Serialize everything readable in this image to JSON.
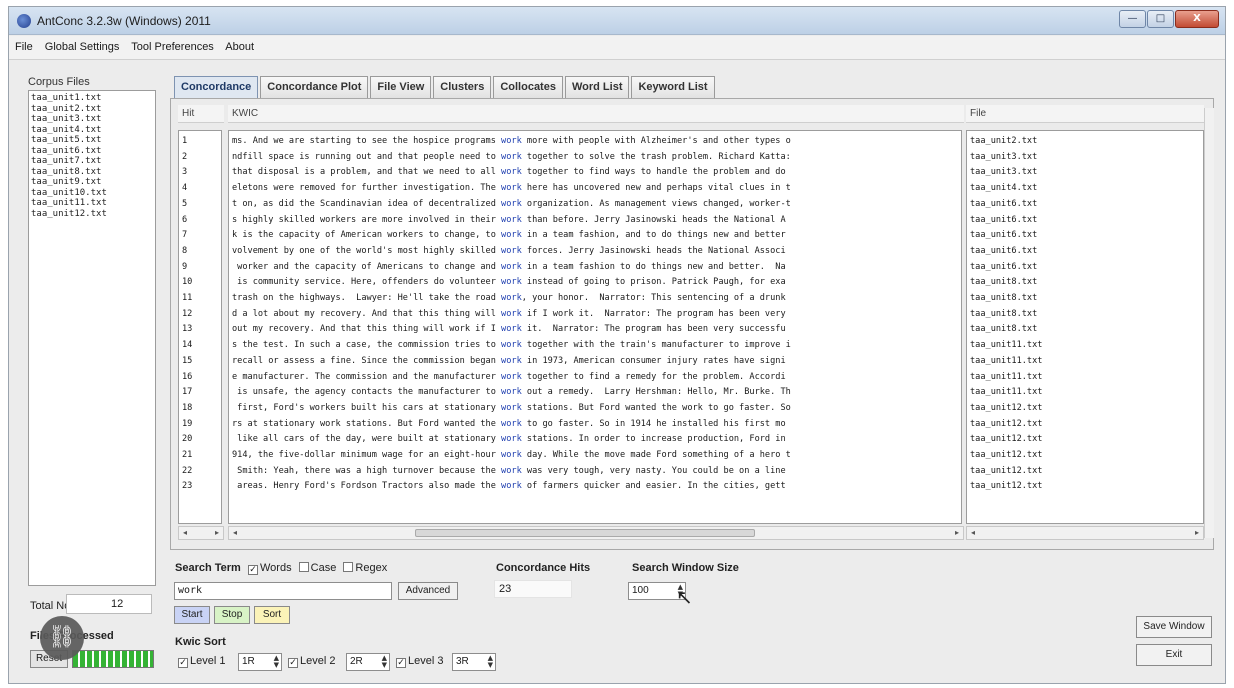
{
  "window": {
    "title": "AntConc 3.2.3w (Windows) 2011",
    "controls": {
      "minimize": "—",
      "maximize": "□",
      "close": "X"
    }
  },
  "menu": [
    "File",
    "Global Settings",
    "Tool Preferences",
    "About"
  ],
  "corpus": {
    "label": "Corpus Files",
    "files": [
      "taa_unit1.txt",
      "taa_unit2.txt",
      "taa_unit3.txt",
      "taa_unit4.txt",
      "taa_unit5.txt",
      "taa_unit6.txt",
      "taa_unit7.txt",
      "taa_unit8.txt",
      "taa_unit9.txt",
      "taa_unit10.txt",
      "taa_unit11.txt",
      "taa_unit12.txt"
    ],
    "total_label": "Total No.",
    "total_value": "12",
    "files_processed_label": "Files Processed",
    "reset_label": "Reset"
  },
  "tabs": [
    "Concordance",
    "Concordance Plot",
    "File View",
    "Clusters",
    "Collocates",
    "Word List",
    "Keyword List"
  ],
  "table": {
    "hit_header": "Hit",
    "kwic_header": "KWIC",
    "file_header": "File",
    "rows": [
      {
        "hit": "1",
        "left": "ms. And we are starting to see the hospice programs ",
        "kw": "work",
        "right": " more with people with Alzheimer's and other types o",
        "file": "taa_unit2.txt"
      },
      {
        "hit": "2",
        "left": "ndfill space is running out and that people need to ",
        "kw": "work",
        "right": " together to solve the trash problem. Richard Katta:",
        "file": "taa_unit3.txt"
      },
      {
        "hit": "3",
        "left": "that disposal is a problem, and that we need to all ",
        "kw": "work",
        "right": " together to find ways to handle the problem and do",
        "file": "taa_unit3.txt"
      },
      {
        "hit": "4",
        "left": "eletons were removed for further investigation. The ",
        "kw": "work",
        "right": " here has uncovered new and perhaps vital clues in t",
        "file": "taa_unit4.txt"
      },
      {
        "hit": "5",
        "left": "t on, as did the Scandinavian idea of decentralized ",
        "kw": "work",
        "right": " organization. As management views changed, worker-t",
        "file": "taa_unit6.txt"
      },
      {
        "hit": "6",
        "left": "s highly skilled workers are more involved in their ",
        "kw": "work",
        "right": " than before. Jerry Jasinowski heads the National A",
        "file": "taa_unit6.txt"
      },
      {
        "hit": "7",
        "left": "k is the capacity of American workers to change, to ",
        "kw": "work",
        "right": " in a team fashion, and to do things new and better",
        "file": "taa_unit6.txt"
      },
      {
        "hit": "8",
        "left": "volvement by one of the world's most highly skilled ",
        "kw": "work",
        "right": " forces. Jerry Jasinowski heads the National Associ",
        "file": "taa_unit6.txt"
      },
      {
        "hit": "9",
        "left": " worker and the capacity of Americans to change and ",
        "kw": "work",
        "right": " in a team fashion to do things new and better.  Na",
        "file": "taa_unit6.txt"
      },
      {
        "hit": "10",
        "left": " is community service. Here, offenders do volunteer ",
        "kw": "work",
        "right": " instead of going to prison. Patrick Paugh, for exa",
        "file": "taa_unit8.txt"
      },
      {
        "hit": "11",
        "left": "trash on the highways.  Lawyer: He'll take the road ",
        "kw": "work",
        "right": ", your honor.  Narrator: This sentencing of a drunk",
        "file": "taa_unit8.txt"
      },
      {
        "hit": "12",
        "left": "d a lot about my recovery. And that this thing will ",
        "kw": "work",
        "right": " if I work it.  Narrator: The program has been very",
        "file": "taa_unit8.txt"
      },
      {
        "hit": "13",
        "left": "out my recovery. And that this thing will work if I ",
        "kw": "work",
        "right": " it.  Narrator: The program has been very successfu",
        "file": "taa_unit8.txt"
      },
      {
        "hit": "14",
        "left": "s the test. In such a case, the commission tries to ",
        "kw": "work",
        "right": " together with the train's manufacturer to improve i",
        "file": "taa_unit11.txt"
      },
      {
        "hit": "15",
        "left": "recall or assess a fine. Since the commission began ",
        "kw": "work",
        "right": " in 1973, American consumer injury rates have signi",
        "file": "taa_unit11.txt"
      },
      {
        "hit": "16",
        "left": "e manufacturer. The commission and the manufacturer ",
        "kw": "work",
        "right": " together to find a remedy for the problem. Accordi",
        "file": "taa_unit11.txt"
      },
      {
        "hit": "17",
        "left": " is unsafe, the agency contacts the manufacturer to ",
        "kw": "work",
        "right": " out a remedy.  Larry Hershman: Hello, Mr. Burke. Th",
        "file": "taa_unit11.txt"
      },
      {
        "hit": "18",
        "left": " first, Ford's workers built his cars at stationary ",
        "kw": "work",
        "right": " stations. But Ford wanted the work to go faster. So",
        "file": "taa_unit12.txt"
      },
      {
        "hit": "19",
        "left": "rs at stationary work stations. But Ford wanted the ",
        "kw": "work",
        "right": " to go faster. So in 1914 he installed his first mo",
        "file": "taa_unit12.txt"
      },
      {
        "hit": "20",
        "left": " like all cars of the day, were built at stationary ",
        "kw": "work",
        "right": " stations. In order to increase production, Ford in",
        "file": "taa_unit12.txt"
      },
      {
        "hit": "21",
        "left": "914, the five-dollar minimum wage for an eight-hour ",
        "kw": "work",
        "right": " day. While the move made Ford something of a hero t",
        "file": "taa_unit12.txt"
      },
      {
        "hit": "22",
        "left": " Smith: Yeah, there was a high turnover because the ",
        "kw": "work",
        "right": " was very tough, very nasty. You could be on a line",
        "file": "taa_unit12.txt"
      },
      {
        "hit": "23",
        "left": " areas. Henry Ford's Fordson Tractors also made the ",
        "kw": "work",
        "right": " of farmers quicker and easier. In the cities, gett",
        "file": "taa_unit12.txt"
      }
    ]
  },
  "search": {
    "term_label": "Search Term",
    "words_label": "Words",
    "case_label": "Case",
    "regex_label": "Regex",
    "value": "work",
    "advanced_label": "Advanced",
    "start_label": "Start",
    "stop_label": "Stop",
    "sort_label": "Sort"
  },
  "hits": {
    "label": "Concordance Hits",
    "value": "23"
  },
  "window_size": {
    "label": "Search Window Size",
    "value": "100"
  },
  "kwic_sort": {
    "label": "Kwic Sort",
    "levels": [
      {
        "label": "Level 1",
        "value": "1R"
      },
      {
        "label": "Level 2",
        "value": "2R"
      },
      {
        "label": "Level 3",
        "value": "3R"
      }
    ]
  },
  "save_window_label": "Save Window",
  "exit_label": "Exit",
  "colors": {
    "keyword": "#1f3fb0",
    "start_btn": "#c9d3f5",
    "stop_btn": "#d8f3c6",
    "sort_btn": "#fbf3b8"
  }
}
